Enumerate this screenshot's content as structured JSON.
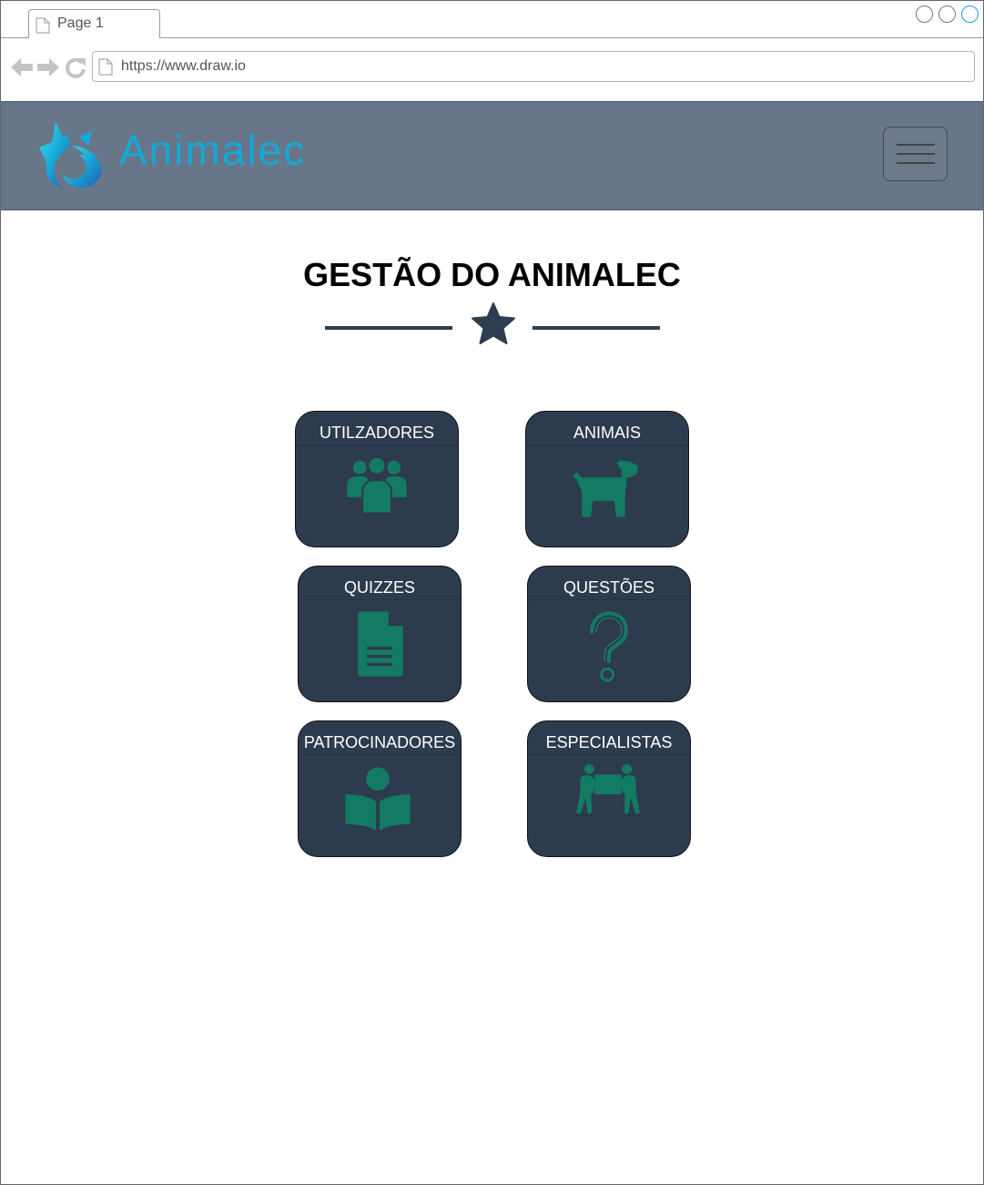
{
  "browser": {
    "tab_label": "Page 1",
    "url": "https://www.draw.io"
  },
  "header": {
    "brand": "Animalec",
    "logo_icon": "fox-logo-icon",
    "menu_icon": "hamburger-menu-icon"
  },
  "main": {
    "title": "GESTÃO DO ANIMALEC",
    "divider_icon": "star-icon",
    "cards": [
      {
        "label": "UTILZADORES",
        "icon": "users-group-icon"
      },
      {
        "label": "ANIMAIS",
        "icon": "dog-icon"
      },
      {
        "label": "QUIZZES",
        "icon": "document-icon"
      },
      {
        "label": "QUESTÕES",
        "icon": "question-mark-icon"
      },
      {
        "label": "PATROCINADORES",
        "icon": "reader-book-icon"
      },
      {
        "label": "ESPECIALISTAS",
        "icon": "people-carrying-box-icon"
      }
    ]
  },
  "colors": {
    "header_bg": "#687689",
    "brand": "#15a8d8",
    "card_bg": "#2d3b4e",
    "icon": "#137a63",
    "divider": "#2d3e50"
  }
}
